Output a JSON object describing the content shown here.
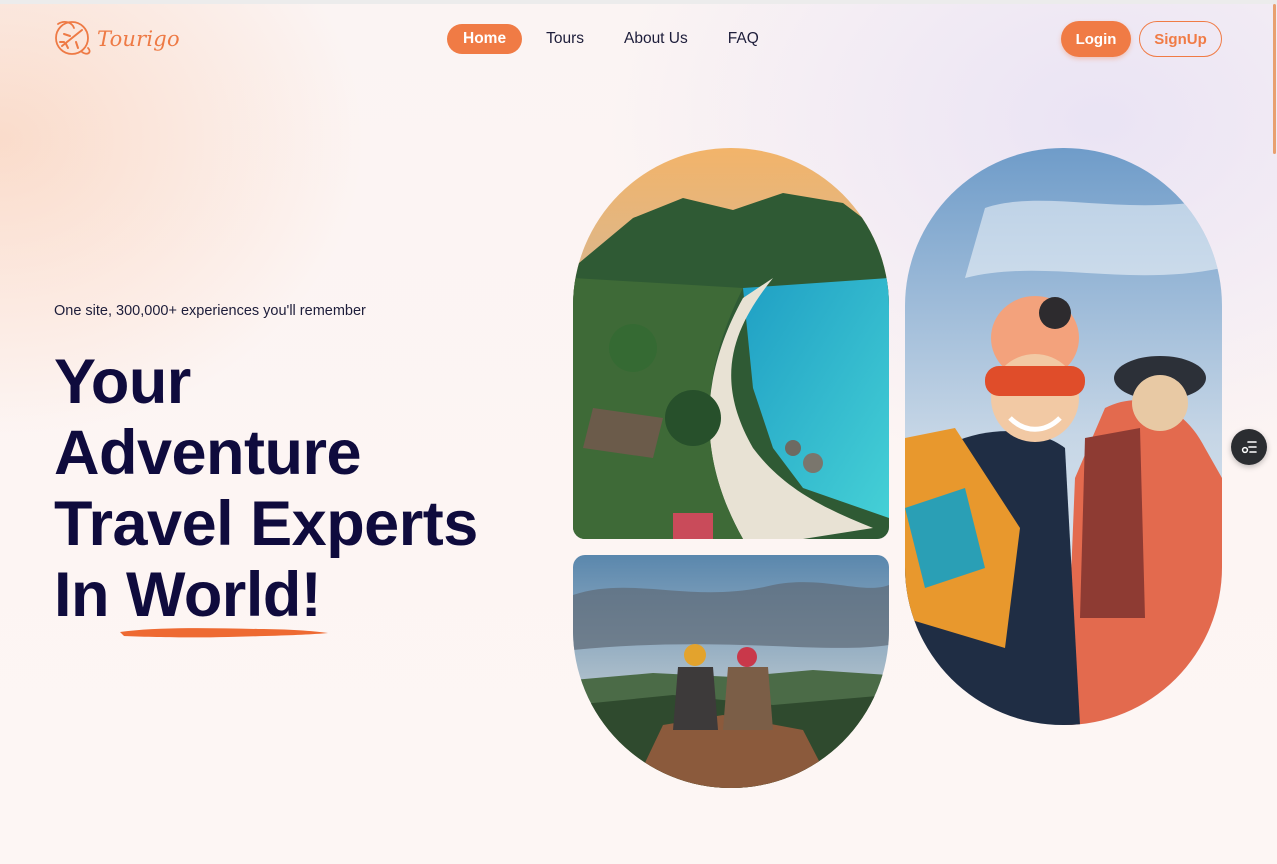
{
  "brand": {
    "name": "Tourigo",
    "logo_icon": "plane-compass-logo-icon",
    "accent_color": "#f07b45",
    "text_color": "#0f0b3d"
  },
  "nav": {
    "items": [
      {
        "label": "Home",
        "active": true
      },
      {
        "label": "Tours",
        "active": false
      },
      {
        "label": "About Us",
        "active": false
      },
      {
        "label": "FAQ",
        "active": false
      }
    ]
  },
  "auth": {
    "login_label": "Login",
    "signup_label": "SignUp"
  },
  "hero": {
    "tagline": "One site, 300,000+ experiences you'll remember",
    "title_line1": "Your",
    "title_line2": "Adventure",
    "title_line3": "Travel Experts",
    "title_line4_prefix": "In ",
    "title_highlight": "World!"
  },
  "images": [
    {
      "name": "tropical-beach-photo"
    },
    {
      "name": "mountain-summit-hikers-photo"
    },
    {
      "name": "smiling-hikers-photo"
    }
  ],
  "floating_button": {
    "icon": "list-settings-icon"
  }
}
